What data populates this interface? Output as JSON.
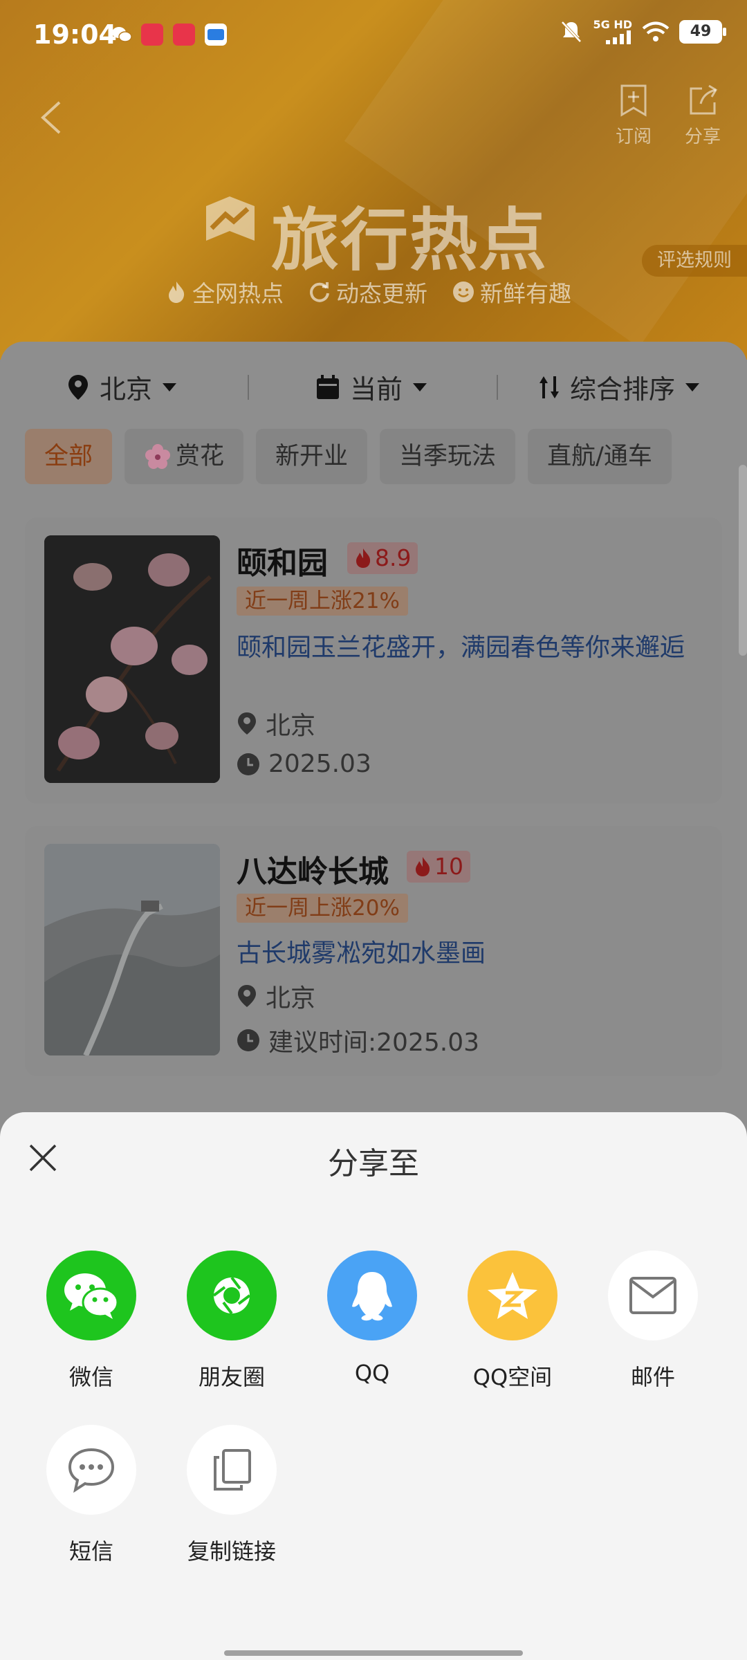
{
  "status_bar": {
    "time": "19:04",
    "network": "5G HD",
    "battery": "49"
  },
  "top_nav": {
    "subscribe_label": "订阅",
    "share_label": "分享"
  },
  "banner": {
    "title": "旅行热点",
    "tags": [
      "全网热点",
      "动态更新",
      "新鲜有趣"
    ],
    "rules_label": "评选规则"
  },
  "filters": {
    "city": "北京",
    "time": "当前",
    "sort": "综合排序"
  },
  "chips": [
    "全部",
    "赏花",
    "新开业",
    "当季玩法",
    "直航/通车"
  ],
  "cards": [
    {
      "name": "颐和园",
      "heat": "8.9",
      "rise": "近一周上涨21%",
      "desc": "颐和园玉兰花盛开，满园春色等你来邂逅",
      "location": "北京",
      "time": "2025.03"
    },
    {
      "name": "八达岭长城",
      "heat": "10",
      "rise": "近一周上涨20%",
      "desc": "古长城雾凇宛如水墨画",
      "location": "北京",
      "time": "建议时间:2025.03"
    }
  ],
  "share_sheet": {
    "title": "分享至",
    "items": [
      {
        "label": "微信",
        "icon": "wechat-icon",
        "color": "#1ec51e"
      },
      {
        "label": "朋友圈",
        "icon": "moments-icon",
        "color": "#1ec51e"
      },
      {
        "label": "QQ",
        "icon": "qq-icon",
        "color": "#4aa3f5"
      },
      {
        "label": "QQ空间",
        "icon": "qzone-icon",
        "color": "#fbc23b"
      },
      {
        "label": "邮件",
        "icon": "mail-icon",
        "color": "#ffffff"
      },
      {
        "label": "短信",
        "icon": "sms-icon",
        "color": "#ffffff"
      },
      {
        "label": "复制链接",
        "icon": "copy-link-icon",
        "color": "#ffffff"
      }
    ]
  }
}
